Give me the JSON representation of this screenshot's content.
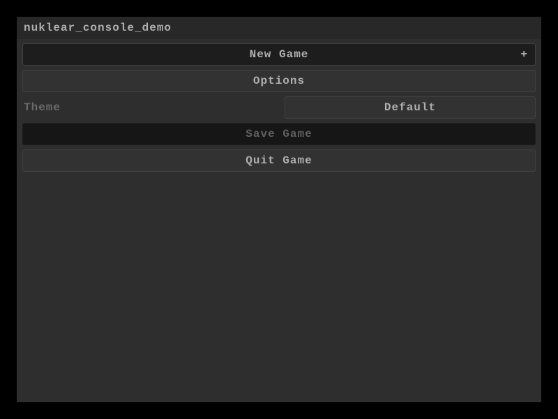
{
  "window": {
    "title": "nuklear_console_demo"
  },
  "menu": {
    "new_game": {
      "label": "New Game",
      "plus": "+"
    },
    "options": {
      "label": "Options"
    },
    "theme": {
      "label": "Theme",
      "value": "Default"
    },
    "save_game": {
      "label": "Save Game"
    },
    "quit_game": {
      "label": "Quit Game"
    }
  },
  "colors": {
    "bg": "#000000",
    "window": "#2e2e2e",
    "titlebar": "#282828",
    "button": "#323232",
    "button_border": "#414141",
    "disabled": "#161616",
    "text": "#afafaf",
    "text_dim": "#6a6a6a"
  }
}
